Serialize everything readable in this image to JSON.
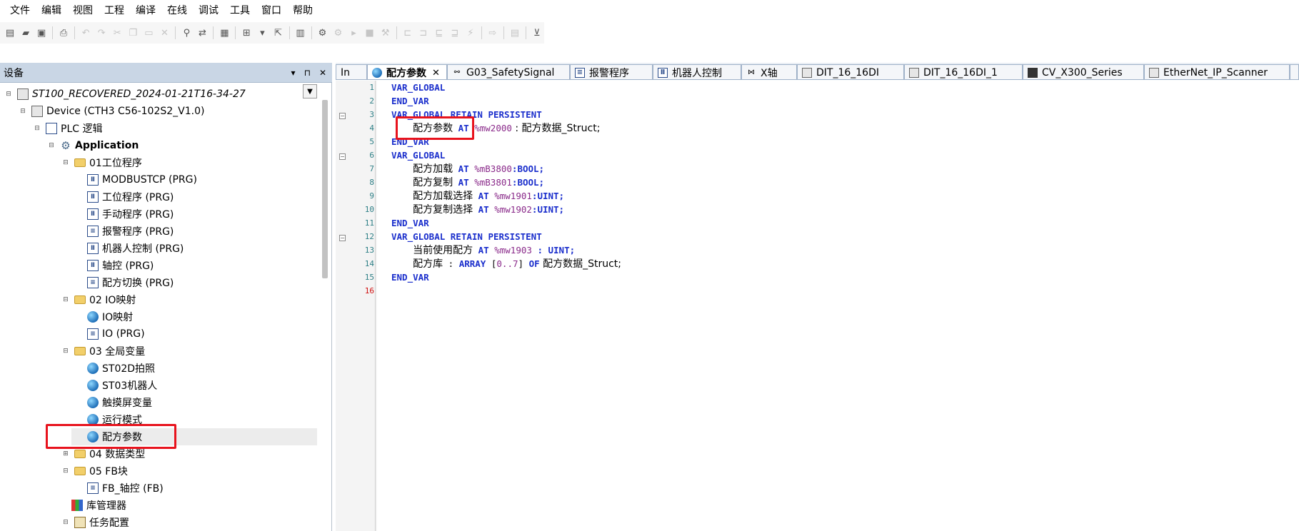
{
  "menu": [
    "文件",
    "编辑",
    "视图",
    "工程",
    "编译",
    "在线",
    "调试",
    "工具",
    "窗口",
    "帮助"
  ],
  "pane": {
    "title": "设备",
    "ctrl_pin": "▾",
    "ctrl_dock": "⊓",
    "ctrl_close": "✕"
  },
  "tree": {
    "project": "ST100_RECOVERED_2024-01-21T16-34-27",
    "device": "Device (CTH3 C56-102S2_V1.0)",
    "plc": "PLC 逻辑",
    "application": "Application",
    "folder1": "01工位程序",
    "f1_items": [
      "MODBUSTCP (PRG)",
      "工位程序 (PRG)",
      "手动程序 (PRG)",
      "报警程序 (PRG)",
      "机器人控制 (PRG)",
      "轴控 (PRG)",
      "配方切换 (PRG)"
    ],
    "folder2": "02 IO映射",
    "f2_items": [
      "IO映射",
      "IO (PRG)"
    ],
    "folder3": "03 全局变量",
    "f3_items": [
      "ST02D拍照",
      "ST03机器人",
      "触摸屏变量",
      "运行模式",
      "配方参数"
    ],
    "folder4": "04 数据类型",
    "folder5": "05 FB块",
    "f5_items": [
      "FB_轴控 (FB)"
    ],
    "libmgr": "库管理器",
    "taskcfg": "任务配置"
  },
  "tabs": [
    "In",
    "配方参数",
    "G03_SafetySignal",
    "报警程序",
    "机器人控制",
    "X轴",
    "DIT_16_16DI",
    "DIT_16_16DI_1",
    "CV_X300_Series",
    "EtherNet_IP_Scanner"
  ],
  "editor": {
    "line_numbers": [
      "1",
      "2",
      "3",
      "4",
      "5",
      "6",
      "7",
      "8",
      "9",
      "10",
      "11",
      "12",
      "13",
      "14",
      "15",
      "16"
    ],
    "l1": "VAR_GLOBAL",
    "l2": "END_VAR",
    "l3": "VAR_GLOBAL RETAIN PERSISTENT",
    "l4_name": "配方参数",
    "l4_at": "AT",
    "l4_addr": "%mw2000",
    "l4_rest": " : 配方数据_Struct;",
    "l5": "END_VAR",
    "l6": "VAR_GLOBAL",
    "l7_name": "配方加载",
    "l7_at": "AT",
    "l7_addr": "%mB3800",
    "l7_rest": ":BOOL;",
    "l8_name": "配方复制",
    "l8_at": "AT",
    "l8_addr": "%mB3801",
    "l8_rest": ":BOOL;",
    "l9_name": "配方加载选择",
    "l9_at": "AT",
    "l9_addr": "%mw1901",
    "l9_rest": ":UINT;",
    "l10_name": "配方复制选择",
    "l10_at": "AT",
    "l10_addr": "%mw1902",
    "l10_rest": ":UINT;",
    "l11": "END_VAR",
    "l12": "VAR_GLOBAL RETAIN PERSISTENT",
    "l13_name": "当前使用配方",
    "l13_at": "AT",
    "l13_addr": "%mw1903",
    "l13_rest": " : UINT;",
    "l14_name": "配方库",
    "l14_colon": " : ",
    "l14_array": "ARRAY",
    "l14_lb": " [",
    "l14_range": "0..7",
    "l14_rb": "] ",
    "l14_of": "OF",
    "l14_type": " 配方数据_Struct;",
    "l15": "END_VAR"
  },
  "colors": {
    "keyword": "#1a2ecc",
    "address": "#8a2a8a",
    "highlight": "#e8131d",
    "pane_header": "#c9d6e5"
  }
}
